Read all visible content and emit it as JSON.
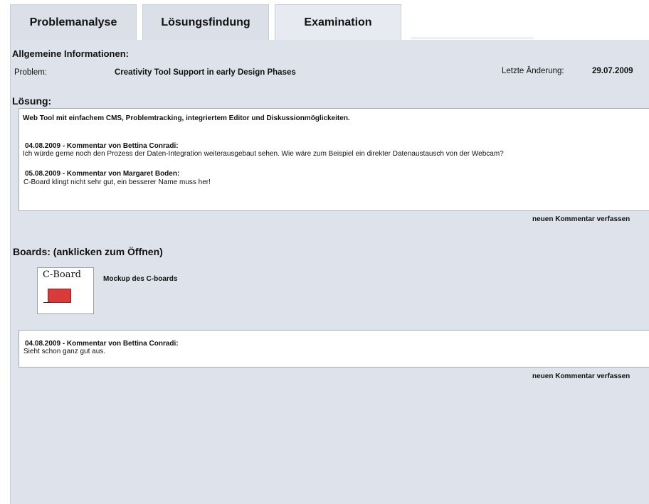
{
  "tabs": [
    "Problemanalyse",
    "Lösungsfindung",
    "Examination"
  ],
  "info": {
    "heading": "Allgemeine Informationen:",
    "problem_label": "Problem:",
    "problem_value": "Creativity Tool Support in early Design Phases",
    "changed_label": "Letzte Änderung:",
    "changed_value": "29.07.2009"
  },
  "loesung": {
    "heading": "Lösung:",
    "text": "Web Tool mit einfachem CMS, Problemtracking, integriertem Editor und Diskussionmöglickeiten.",
    "comments": [
      {
        "header": "04.08.2009 - Kommentar von Bettina Conradi:",
        "body": "Ich würde gerne noch den Prozess der Daten-Integration weiterausgebaut sehen. Wie wäre zum Beispiel ein direkter Datenaustausch von der Webcam?"
      },
      {
        "header": "05.08.2009 - Kommentar von Margaret Boden:",
        "body": "C-Board klingt nicht sehr gut, ein besserer Name muss her!"
      }
    ],
    "new_comment": "neuen Kommentar verfassen"
  },
  "boards": {
    "heading": "Boards: (anklicken zum Öffnen)",
    "items": [
      {
        "thumb_text": "C-Board",
        "label": "Mockup des C-boards",
        "accent": "#d93a3a"
      }
    ],
    "comments": [
      {
        "header": "04.08.2009 - Kommentar von Bettina Conradi:",
        "body": "Sieht schon ganz gut aus."
      }
    ],
    "new_comment": "neuen Kommentar verfassen"
  }
}
